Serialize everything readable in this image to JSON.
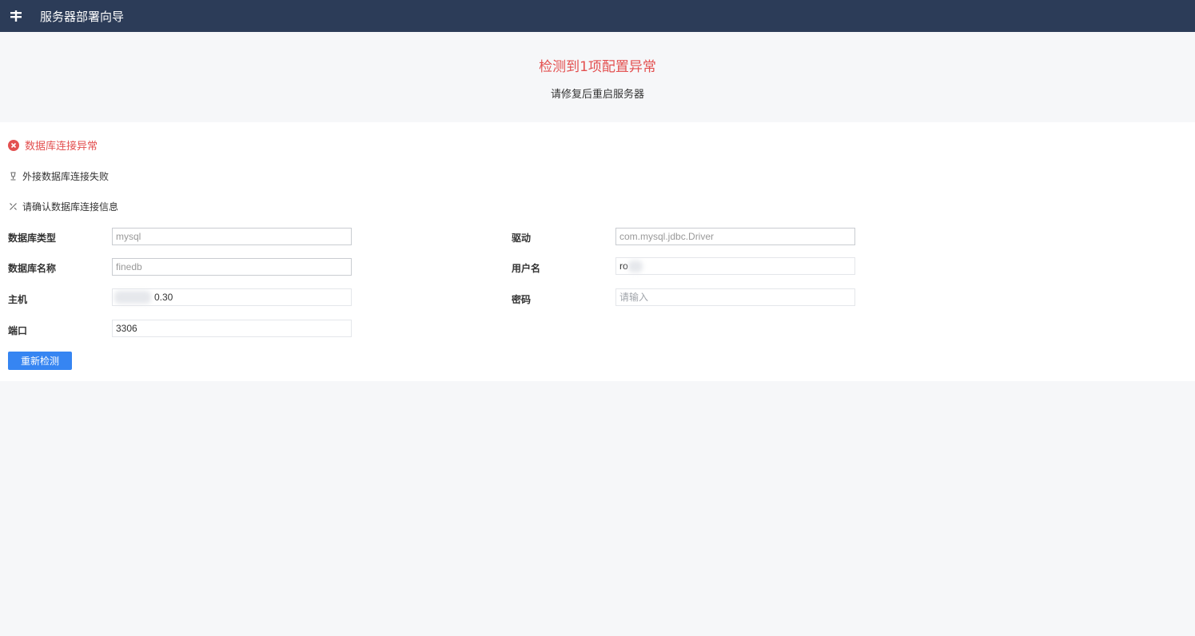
{
  "header": {
    "title": "服务器部署向导"
  },
  "banner": {
    "alert_title": "检测到1项配置异常",
    "alert_subtitle": "请修复后重启服务器"
  },
  "error": {
    "heading": "数据库连接异常",
    "reason": "外接数据库连接失败",
    "suggestion": "请确认数据库连接信息"
  },
  "form": {
    "db_type": {
      "label": "数据库类型",
      "value": "mysql"
    },
    "db_name": {
      "label": "数据库名称",
      "value": "finedb"
    },
    "host": {
      "label": "主机",
      "value": "0.30"
    },
    "port": {
      "label": "端口",
      "value": "3306"
    },
    "driver": {
      "label": "驱动",
      "value": "com.mysql.jdbc.Driver"
    },
    "username": {
      "label": "用户名",
      "value": "ro"
    },
    "password": {
      "label": "密码",
      "placeholder": "请输入"
    }
  },
  "actions": {
    "recheck_label": "重新检测"
  },
  "colors": {
    "topbar": "#2c3c58",
    "error": "#e35050",
    "primary": "#3685f2"
  }
}
